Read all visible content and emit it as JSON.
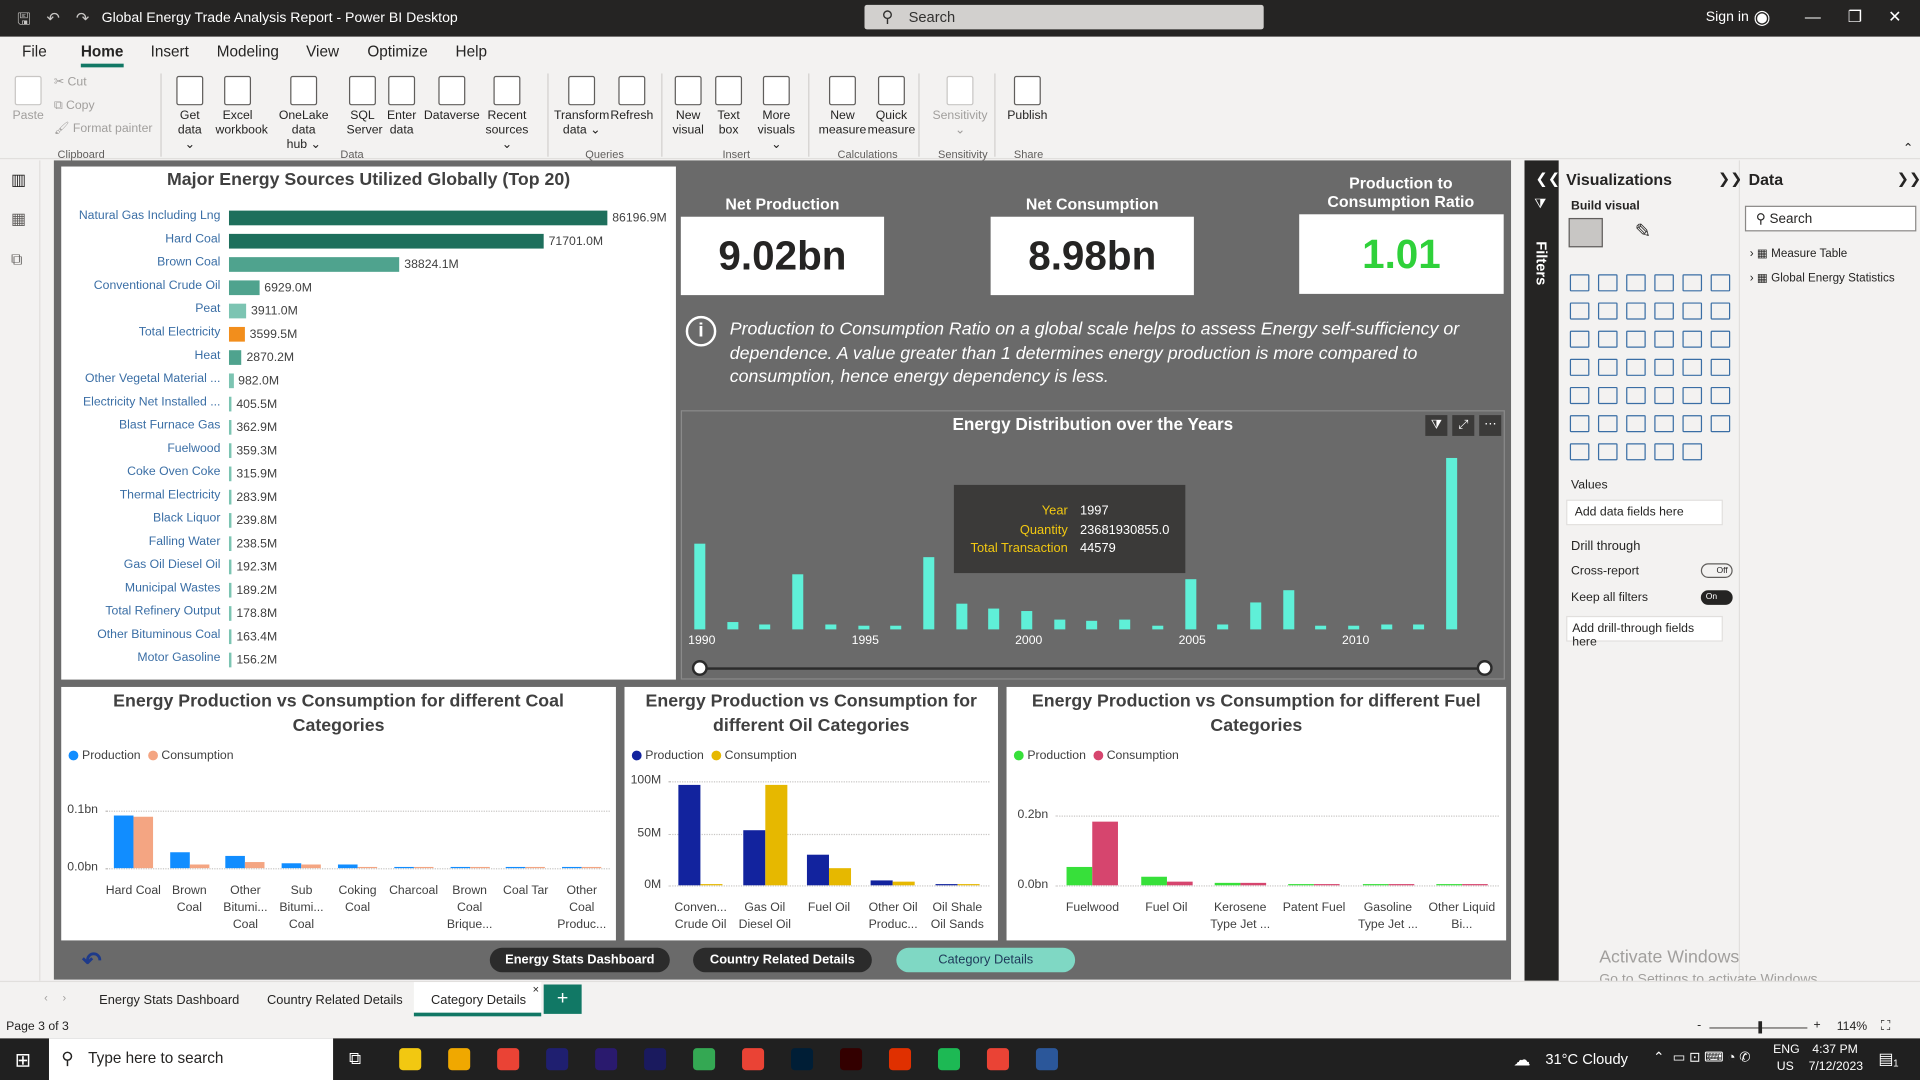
{
  "window": {
    "title": "Global Energy Trade Analysis Report - Power BI Desktop",
    "search_placeholder": "Search",
    "signin": "Sign in"
  },
  "menu": [
    "File",
    "Home",
    "Insert",
    "Modeling",
    "View",
    "Optimize",
    "Help"
  ],
  "clipboard": {
    "paste": "Paste",
    "cut": "Cut",
    "copy": "Copy",
    "format_painter": "Format painter",
    "group": "Clipboard"
  },
  "ribbon": [
    {
      "label1": "Get",
      "label2": "data ⌄"
    },
    {
      "label1": "Excel",
      "label2": "workbook"
    },
    {
      "label1": "OneLake data",
      "label2": "hub ⌄"
    },
    {
      "label1": "SQL",
      "label2": "Server"
    },
    {
      "label1": "Enter",
      "label2": "data"
    },
    {
      "label1": "Dataverse",
      "label2": ""
    },
    {
      "label1": "Recent",
      "label2": "sources ⌄"
    },
    {
      "label1": "Transform",
      "label2": "data ⌄"
    },
    {
      "label1": "Refresh",
      "label2": ""
    },
    {
      "label1": "New",
      "label2": "visual"
    },
    {
      "label1": "Text",
      "label2": "box"
    },
    {
      "label1": "More",
      "label2": "visuals ⌄"
    },
    {
      "label1": "New",
      "label2": "measure"
    },
    {
      "label1": "Quick",
      "label2": "measure"
    },
    {
      "label1": "Sensitivity",
      "label2": "⌄"
    },
    {
      "label1": "Publish",
      "label2": ""
    }
  ],
  "ribbon_groups": [
    "Data",
    "Queries",
    "Insert",
    "Calculations",
    "Sensitivity",
    "Share"
  ],
  "top20": {
    "title": "Major Energy Sources Utilized Globally (Top 20)",
    "items": [
      {
        "label": "Natural Gas Including Lng",
        "value": 86196.9,
        "text": "86196.9M",
        "color": "#1e6f5c"
      },
      {
        "label": "Hard Coal",
        "value": 71701.0,
        "text": "71701.0M",
        "color": "#1e6f5c"
      },
      {
        "label": "Brown Coal",
        "value": 38824.1,
        "text": "38824.1M",
        "color": "#4fa38e"
      },
      {
        "label": "Conventional Crude Oil",
        "value": 6929.0,
        "text": "6929.0M",
        "color": "#4fa38e"
      },
      {
        "label": "Peat",
        "value": 3911.0,
        "text": "3911.0M",
        "color": "#7cc4b2"
      },
      {
        "label": "Total Electricity",
        "value": 3599.5,
        "text": "3599.5M",
        "color": "#f28e1c"
      },
      {
        "label": "Heat",
        "value": 2870.2,
        "text": "2870.2M",
        "color": "#4fa38e"
      },
      {
        "label": "Other Vegetal Material ...",
        "value": 982.0,
        "text": "982.0M",
        "color": "#7cc4b2"
      },
      {
        "label": "Electricity Net Installed ...",
        "value": 405.5,
        "text": "405.5M",
        "color": "#7cc4b2"
      },
      {
        "label": "Blast Furnace Gas",
        "value": 362.9,
        "text": "362.9M",
        "color": "#7cc4b2"
      },
      {
        "label": "Fuelwood",
        "value": 359.3,
        "text": "359.3M",
        "color": "#7cc4b2"
      },
      {
        "label": "Coke Oven Coke",
        "value": 315.9,
        "text": "315.9M",
        "color": "#7cc4b2"
      },
      {
        "label": "Thermal Electricity",
        "value": 283.9,
        "text": "283.9M",
        "color": "#7cc4b2"
      },
      {
        "label": "Black Liquor",
        "value": 239.8,
        "text": "239.8M",
        "color": "#7cc4b2"
      },
      {
        "label": "Falling Water",
        "value": 238.5,
        "text": "238.5M",
        "color": "#7cc4b2"
      },
      {
        "label": "Gas Oil Diesel Oil",
        "value": 192.3,
        "text": "192.3M",
        "color": "#7cc4b2"
      },
      {
        "label": "Municipal Wastes",
        "value": 189.2,
        "text": "189.2M",
        "color": "#7cc4b2"
      },
      {
        "label": "Total Refinery Output",
        "value": 178.8,
        "text": "178.8M",
        "color": "#7cc4b2"
      },
      {
        "label": "Other Bituminous Coal",
        "value": 163.4,
        "text": "163.4M",
        "color": "#7cc4b2"
      },
      {
        "label": "Motor Gasoline",
        "value": 156.2,
        "text": "156.2M",
        "color": "#7cc4b2"
      }
    ]
  },
  "kpis": [
    {
      "title": "Net Production",
      "value": "9.02bn",
      "color": "#252423"
    },
    {
      "title": "Net Consumption",
      "value": "8.98bn",
      "color": "#252423"
    },
    {
      "title": "Production to Consumption Ratio",
      "value": "1.01",
      "color": "#2fd13a"
    }
  ],
  "note": "Production to Consumption Ratio on a global scale helps to assess Energy self-sufficiency or dependence. A value greater than 1 determines energy production is more compared to consumption, hence energy dependency is less.",
  "distribution": {
    "title": "Energy Distribution over the Years",
    "x_ticks": [
      "1990",
      "1995",
      "2000",
      "2005",
      "2010"
    ],
    "years": [
      1990,
      1991,
      1992,
      1993,
      1994,
      1995,
      1996,
      1997,
      1998,
      1999,
      2000,
      2001,
      2002,
      2003,
      2004,
      2005,
      2006,
      2007,
      2008,
      2009,
      2010,
      2011,
      2012,
      2013,
      2014
    ],
    "relative": [
      0.5,
      0.04,
      0.03,
      0.32,
      0.03,
      0.02,
      0.015,
      0.42,
      0.15,
      0.12,
      0.11,
      0.06,
      0.05,
      0.06,
      0.02,
      0.29,
      0.03,
      0.16,
      0.23,
      0.02,
      0.02,
      0.03,
      0.03,
      1.0,
      0
    ],
    "tooltip": {
      "year_label": "Year",
      "year": "1997",
      "qty_label": "Quantity",
      "qty": "23681930855.0",
      "tx_label": "Total Transaction",
      "tx": "44579"
    }
  },
  "coal": {
    "title": "Energy Production vs Consumption for different Coal Categories",
    "legend": [
      "Production",
      "Consumption"
    ],
    "colors": [
      "#118dff",
      "#f4a582"
    ],
    "yticks": [
      "0.1bn",
      "0.0bn"
    ],
    "categories": [
      "Hard Coal",
      "Brown Coal",
      "Other Bitumi... Coal",
      "Sub Bitumi... Coal",
      "Coking Coal",
      "Charcoal",
      "Brown Coal Brique...",
      "Coal Tar",
      "Other Coal Produc..."
    ],
    "production": [
      0.12,
      0.035,
      0.027,
      0.012,
      0.007,
      0.001,
      0.002,
      0.001,
      0.001
    ],
    "consumption": [
      0.117,
      0.007,
      0.013,
      0.009,
      0.004,
      0.004,
      0.002,
      0.002,
      0.001
    ],
    "ymax": 0.13
  },
  "oil": {
    "title": "Energy Production vs Consumption for different Oil Categories",
    "legend": [
      "Production",
      "Consumption"
    ],
    "colors": [
      "#12239e",
      "#e6b800"
    ],
    "yticks": [
      "100M",
      "50M",
      "0M"
    ],
    "categories": [
      "Conven... Crude Oil",
      "Gas Oil Diesel Oil",
      "Fuel Oil",
      "Other Oil Produc...",
      "Oil Shale Oil Sands"
    ],
    "production": [
      97,
      53,
      30,
      5,
      1
    ],
    "consumption": [
      1,
      97,
      17,
      3,
      1
    ],
    "ymax": 100
  },
  "fuel": {
    "title": "Energy Production vs Consumption for different Fuel Categories",
    "legend": [
      "Production",
      "Consumption"
    ],
    "colors": [
      "#37e03a",
      "#d6456e"
    ],
    "yticks": [
      "0.2bn",
      "0.0bn"
    ],
    "categories": [
      "Fuelwood",
      "Fuel Oil",
      "Kerosene Type Jet ...",
      "Patent Fuel",
      "Gasoline Type Jet ...",
      "Other Liquid Bi..."
    ],
    "production": [
      0.062,
      0.027,
      0.009,
      0.002,
      0.002,
      0.002
    ],
    "consumption": [
      0.21,
      0.014,
      0.008,
      0.002,
      0.002,
      0.002
    ],
    "ymax": 0.23
  },
  "nav_buttons": [
    "Energy Stats Dashboard",
    "Country Related Details",
    "Category Details"
  ],
  "viz_pane": {
    "title": "Visualizations",
    "build": "Build visual",
    "values": "Values",
    "add_fields": "Add data fields here",
    "drill": "Drill through",
    "cross": "Cross-report",
    "cross_state": "Off",
    "keep": "Keep all filters",
    "keep_state": "On",
    "add_drill": "Add drill-through fields here"
  },
  "filters_label": "Filters",
  "data_pane": {
    "title": "Data",
    "search": "Search",
    "tables": [
      "Measure Table",
      "Global Energy Statistics"
    ]
  },
  "tabs": [
    "Energy Stats Dashboard",
    "Country Related Details",
    "Category Details"
  ],
  "status": {
    "page": "Page 3 of 3",
    "zoom": "114%"
  },
  "watermark": {
    "l1": "Activate Windows",
    "l2": "Go to Settings to activate Windows."
  },
  "taskbar": {
    "search": "Type here to search",
    "weather": "31°C  Cloudy",
    "lang1": "ENG",
    "lang2": "US",
    "time": "4:37 PM",
    "date": "7/12/2023",
    "notif": "1"
  }
}
